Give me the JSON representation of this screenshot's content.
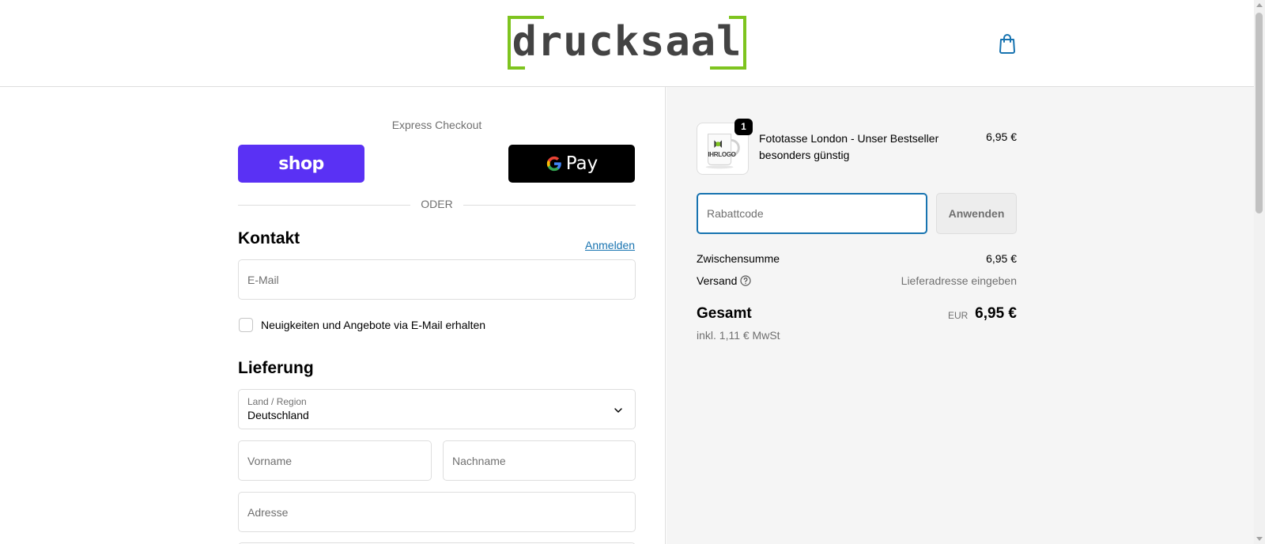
{
  "header": {
    "logo_text": "drucksaal",
    "brand_color": "#7ec41f",
    "cart_icon": "shopping-bag-icon"
  },
  "express": {
    "title": "Express Checkout",
    "shop_label": "shop",
    "gpay_label": "Pay",
    "divider": "ODER"
  },
  "contact": {
    "title": "Kontakt",
    "login_link": "Anmelden",
    "email_placeholder": "E-Mail",
    "newsletter_label": "Neuigkeiten und Angebote via E-Mail erhalten",
    "newsletter_checked": false
  },
  "delivery": {
    "title": "Lieferung",
    "country_label": "Land / Region",
    "country_value": "Deutschland",
    "first_name_placeholder": "Vorname",
    "last_name_placeholder": "Nachname",
    "address_placeholder": "Adresse"
  },
  "summary": {
    "product": {
      "name": "Fototasse London - Unser Bestseller besonders günstig",
      "price": "6,95 €",
      "quantity": "1",
      "thumb_text": "IHRLOGO"
    },
    "discount_placeholder": "Rabattcode",
    "apply_label": "Anwenden",
    "subtotal_label": "Zwischensumme",
    "subtotal_value": "6,95 €",
    "shipping_label": "Versand",
    "shipping_value": "Lieferadresse eingeben",
    "total_label": "Gesamt",
    "total_currency": "EUR",
    "total_value": "6,95 €",
    "tax_note": "inkl. 1,11 € MwSt"
  },
  "colors": {
    "shop_pay": "#5a31f4",
    "link": "#1773b0",
    "focus_border": "#1773b0"
  }
}
